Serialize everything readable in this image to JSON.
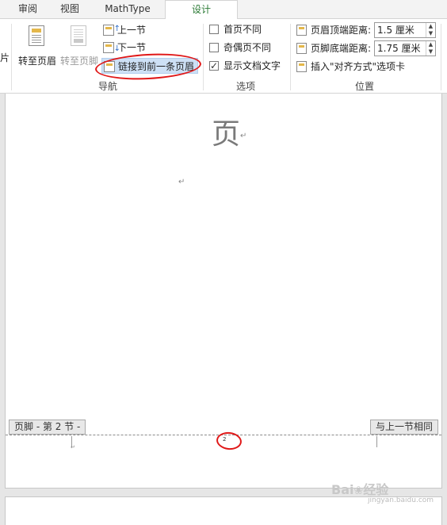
{
  "tabs": [
    {
      "label": "审阅"
    },
    {
      "label": "视图"
    },
    {
      "label": "MathType"
    },
    {
      "label": "设计"
    }
  ],
  "ribbon": {
    "navigation": {
      "group_label": "导航",
      "clipped_left_label": "片",
      "goto_header": "转至页眉",
      "goto_footer": "转至页脚",
      "previous_section": "上一节",
      "next_section": "下一节",
      "link_to_previous": "链接到前一条页眉"
    },
    "options": {
      "group_label": "选项",
      "different_first_page": {
        "label": "首页不同",
        "checked": false
      },
      "different_odd_even": {
        "label": "奇偶页不同",
        "checked": false
      },
      "show_document_text": {
        "label": "显示文档文字",
        "checked": true
      }
    },
    "position": {
      "group_label": "位置",
      "header_from_top_label": "页眉顶端距离:",
      "header_from_top_value": "1.5 厘米",
      "footer_from_bottom_label": "页脚底端距离:",
      "footer_from_bottom_value": "1.75 厘米",
      "insert_align_tab": "插入\"对齐方式\"选项卡"
    }
  },
  "document": {
    "heading_char": "页",
    "paragraph_mark": "↵",
    "footer_tag": "页脚 - 第 2 节 -",
    "same_as_previous": "与上一节相同",
    "page_number": "2"
  },
  "watermark": {
    "text": "Bai",
    "paw": "❀",
    "suffix": "经验",
    "url": "jingyan.baidu.com"
  },
  "colors": {
    "active_tab": "#2b7a35",
    "annotation_red": "#e01818",
    "selection_blue": "#cde0f5"
  }
}
